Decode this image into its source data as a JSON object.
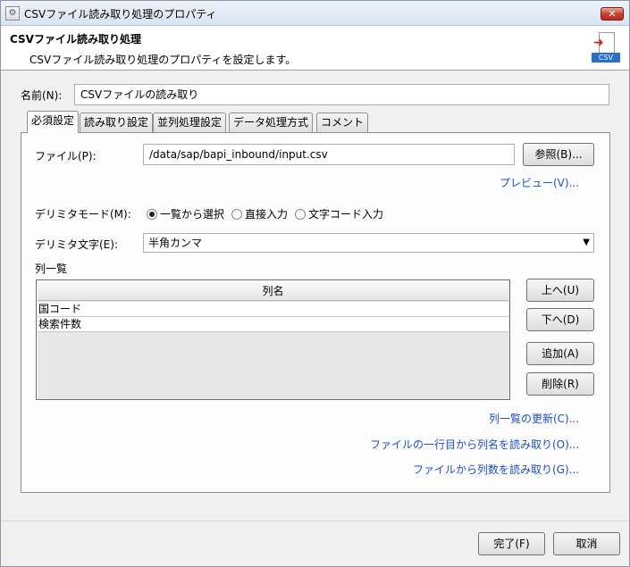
{
  "window": {
    "title": "CSVファイル読み取り処理のプロパティ",
    "close_symbol": "✕"
  },
  "header": {
    "title": "CSVファイル読み取り処理",
    "description": "CSVファイル読み取り処理のプロパティを設定します。",
    "icon_label": "CSV",
    "icon": "csv-file-icon"
  },
  "name_field": {
    "label": "名前(N):",
    "value": "CSVファイルの読み取り"
  },
  "tabs": [
    {
      "label": "必須設定",
      "active": true
    },
    {
      "label": "読み取り設定",
      "active": false
    },
    {
      "label": "並列処理設定",
      "active": false
    },
    {
      "label": "データ処理方式",
      "active": false
    },
    {
      "label": "コメント",
      "active": false
    }
  ],
  "file": {
    "label": "ファイル(P):",
    "value": "/data/sap/bapi_inbound/input.csv",
    "browse_label": "参照(B)...",
    "preview_link": "プレビュー(V)..."
  },
  "delimiter_mode": {
    "label": "デリミタモード(M):",
    "options": [
      {
        "label": "一覧から選択",
        "checked": true
      },
      {
        "label": "直接入力",
        "checked": false
      },
      {
        "label": "文字コード入力",
        "checked": false
      }
    ]
  },
  "delimiter_char": {
    "label": "デリミタ文字(E):",
    "value": "半角カンマ"
  },
  "columns": {
    "section_label": "列一覧",
    "header": "列名",
    "rows": [
      "国コード",
      "検索件数"
    ],
    "buttons": {
      "up": "上へ(U)",
      "down": "下へ(D)",
      "add": "追加(A)",
      "delete": "削除(R)"
    },
    "links": {
      "refresh": "列一覧の更新(C)...",
      "read_names": "ファイルの一行目から列名を読み取り(O)...",
      "read_count": "ファイルから列数を読み取り(G)..."
    }
  },
  "footer": {
    "ok_label": "完了(F)",
    "cancel_label": "取消"
  }
}
